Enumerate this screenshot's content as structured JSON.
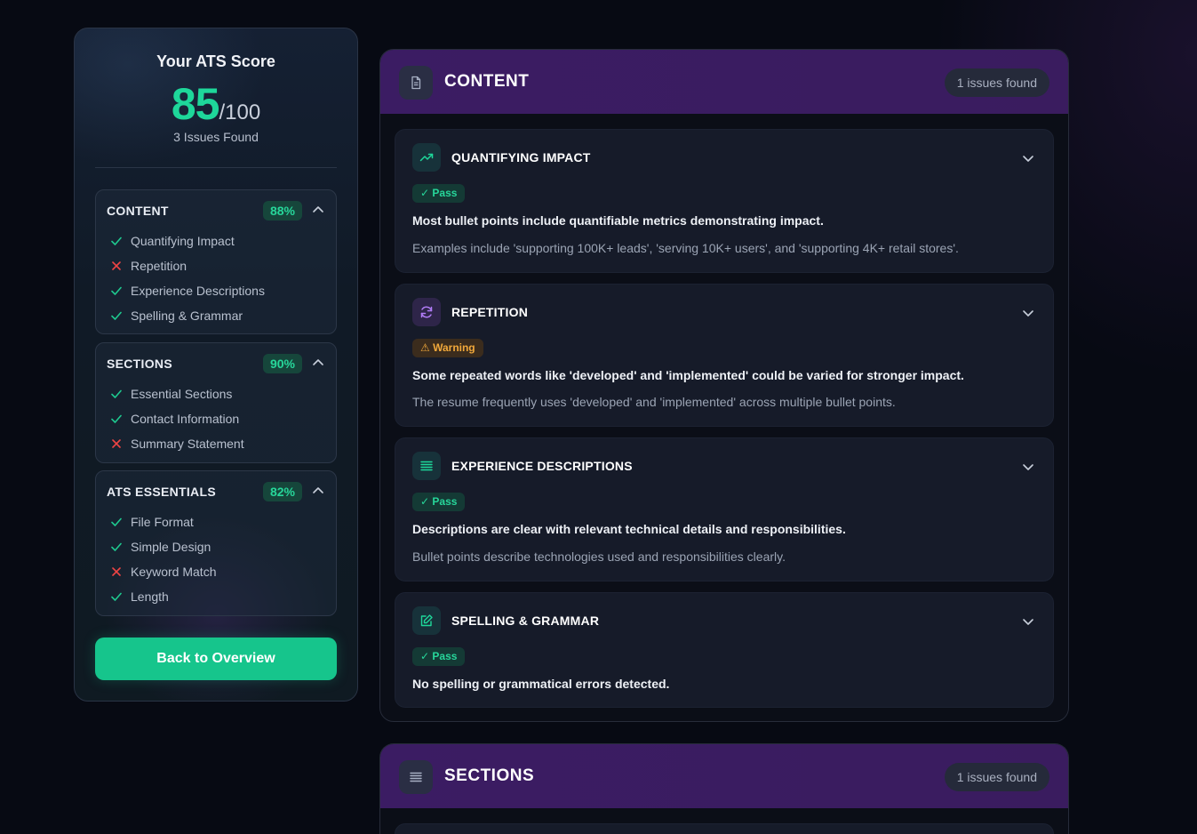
{
  "score": {
    "title": "Your ATS Score",
    "value": "85",
    "out_of": "/100",
    "issues_found": "3 Issues Found"
  },
  "categories": [
    {
      "name": "CONTENT",
      "percent": "88%",
      "items": [
        {
          "label": "Quantifying Impact",
          "status": "pass"
        },
        {
          "label": "Repetition",
          "status": "fail"
        },
        {
          "label": "Experience Descriptions",
          "status": "pass"
        },
        {
          "label": "Spelling & Grammar",
          "status": "pass"
        }
      ]
    },
    {
      "name": "SECTIONS",
      "percent": "90%",
      "items": [
        {
          "label": "Essential Sections",
          "status": "pass"
        },
        {
          "label": "Contact Information",
          "status": "pass"
        },
        {
          "label": "Summary Statement",
          "status": "fail"
        }
      ]
    },
    {
      "name": "ATS ESSENTIALS",
      "percent": "82%",
      "items": [
        {
          "label": "File Format",
          "status": "pass"
        },
        {
          "label": "Simple Design",
          "status": "pass"
        },
        {
          "label": "Keyword Match",
          "status": "fail"
        },
        {
          "label": "Length",
          "status": "pass"
        }
      ]
    }
  ],
  "back_button": "Back to Overview",
  "content_panel": {
    "title": "CONTENT",
    "issues": "1 issues found",
    "checks": [
      {
        "title": "QUANTIFYING IMPACT",
        "badge": "✓ Pass",
        "description": "Most bullet points include quantifiable metrics demonstrating impact.",
        "detail": "Examples include 'supporting 100K+ leads', 'serving 10K+ users', and 'supporting 4K+ retail stores'."
      },
      {
        "title": "REPETITION",
        "badge": "⚠ Warning",
        "description": "Some repeated words like 'developed' and 'implemented' could be varied for stronger impact.",
        "detail": "The resume frequently uses 'developed' and 'implemented' across multiple bullet points."
      },
      {
        "title": "EXPERIENCE DESCRIPTIONS",
        "badge": "✓ Pass",
        "description": "Descriptions are clear with relevant technical details and responsibilities.",
        "detail": "Bullet points describe technologies used and responsibilities clearly."
      },
      {
        "title": "SPELLING & GRAMMAR",
        "badge": "✓ Pass",
        "description": "No spelling or grammatical errors detected."
      }
    ]
  },
  "sections_panel": {
    "title": "SECTIONS",
    "issues": "1 issues found"
  },
  "colors": {
    "accent_green": "#1ed79a",
    "warning_orange": "#f2a93b",
    "fail_red": "#ef4444",
    "header_purple": "#3b1c63"
  }
}
